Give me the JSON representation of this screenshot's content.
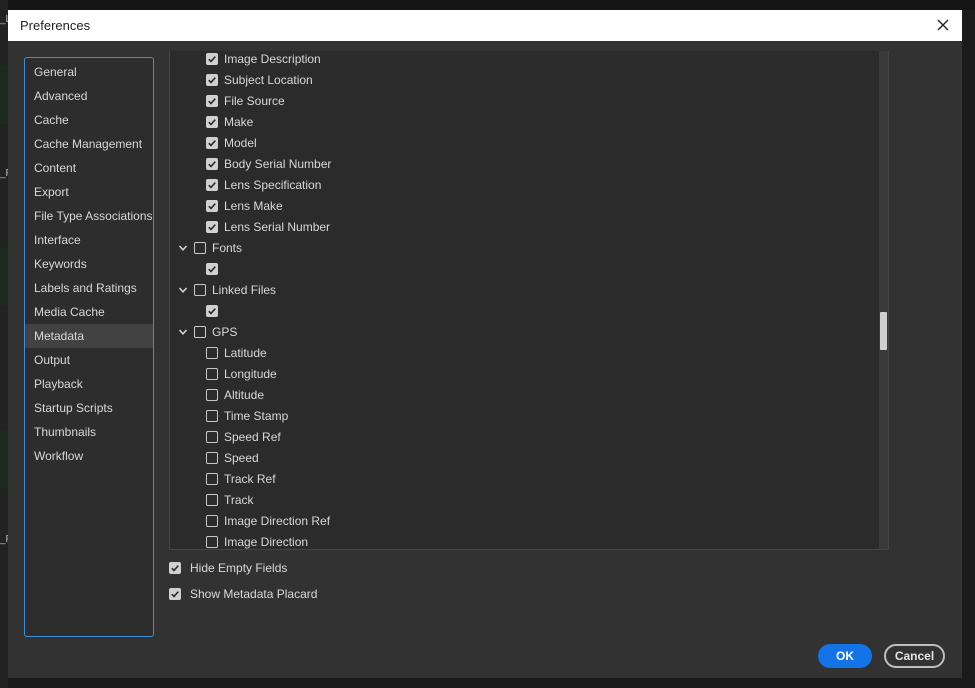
{
  "window": {
    "title": "Preferences"
  },
  "sidebar": {
    "items": [
      {
        "label": "General",
        "active": false
      },
      {
        "label": "Advanced",
        "active": false
      },
      {
        "label": "Cache",
        "active": false
      },
      {
        "label": "Cache Management",
        "active": false
      },
      {
        "label": "Content",
        "active": false
      },
      {
        "label": "Export",
        "active": false
      },
      {
        "label": "File Type Associations",
        "active": false
      },
      {
        "label": "Interface",
        "active": false
      },
      {
        "label": "Keywords",
        "active": false
      },
      {
        "label": "Labels and Ratings",
        "active": false
      },
      {
        "label": "Media Cache",
        "active": false
      },
      {
        "label": "Metadata",
        "active": true
      },
      {
        "label": "Output",
        "active": false
      },
      {
        "label": "Playback",
        "active": false
      },
      {
        "label": "Startup Scripts",
        "active": false
      },
      {
        "label": "Thumbnails",
        "active": false
      },
      {
        "label": "Workflow",
        "active": false
      }
    ]
  },
  "metadata_tree": {
    "rows": [
      {
        "label": "Image Description",
        "checked": true,
        "level": 1,
        "expandable": false
      },
      {
        "label": "Subject Location",
        "checked": true,
        "level": 1,
        "expandable": false
      },
      {
        "label": "File Source",
        "checked": true,
        "level": 1,
        "expandable": false
      },
      {
        "label": "Make",
        "checked": true,
        "level": 1,
        "expandable": false
      },
      {
        "label": "Model",
        "checked": true,
        "level": 1,
        "expandable": false
      },
      {
        "label": "Body Serial Number",
        "checked": true,
        "level": 1,
        "expandable": false
      },
      {
        "label": "Lens Specification",
        "checked": true,
        "level": 1,
        "expandable": false
      },
      {
        "label": "Lens Make",
        "checked": true,
        "level": 1,
        "expandable": false
      },
      {
        "label": "Lens Serial Number",
        "checked": true,
        "level": 1,
        "expandable": false
      },
      {
        "label": "Fonts",
        "checked": false,
        "level": 0,
        "expandable": true
      },
      {
        "label": "",
        "checked": true,
        "level": 1,
        "expandable": false
      },
      {
        "label": "Linked Files",
        "checked": false,
        "level": 0,
        "expandable": true
      },
      {
        "label": "",
        "checked": true,
        "level": 1,
        "expandable": false
      },
      {
        "label": "GPS",
        "checked": false,
        "level": 0,
        "expandable": true
      },
      {
        "label": "Latitude",
        "checked": false,
        "level": 1,
        "expandable": false
      },
      {
        "label": "Longitude",
        "checked": false,
        "level": 1,
        "expandable": false
      },
      {
        "label": "Altitude",
        "checked": false,
        "level": 1,
        "expandable": false
      },
      {
        "label": "Time Stamp",
        "checked": false,
        "level": 1,
        "expandable": false
      },
      {
        "label": "Speed Ref",
        "checked": false,
        "level": 1,
        "expandable": false
      },
      {
        "label": "Speed",
        "checked": false,
        "level": 1,
        "expandable": false
      },
      {
        "label": "Track Ref",
        "checked": false,
        "level": 1,
        "expandable": false
      },
      {
        "label": "Track",
        "checked": false,
        "level": 1,
        "expandable": false
      },
      {
        "label": "Image Direction Ref",
        "checked": false,
        "level": 1,
        "expandable": false
      },
      {
        "label": "Image Direction",
        "checked": false,
        "level": 1,
        "expandable": false
      }
    ]
  },
  "options": {
    "hide_empty_fields": {
      "label": "Hide Empty Fields",
      "checked": true
    },
    "show_metadata_placard": {
      "label": "Show Metadata Placard",
      "checked": true
    }
  },
  "buttons": {
    "ok": "OK",
    "cancel": "Cancel"
  },
  "background": {
    "labels": [
      "_L",
      "_F",
      "_F"
    ]
  },
  "colors": {
    "accent": "#1473e6",
    "sidebar_border": "#3d8fd8",
    "dialog_bg": "#323232"
  }
}
